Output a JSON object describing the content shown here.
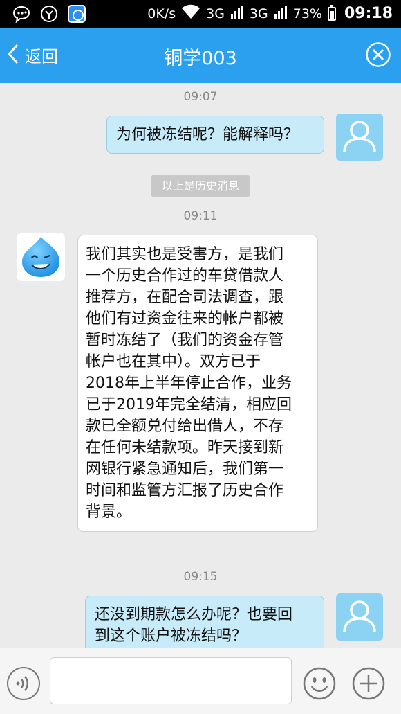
{
  "statusbar": {
    "network_speed": "0K/s",
    "signal1": "3G",
    "signal2": "3G",
    "battery": "73%",
    "time": "09:18"
  },
  "header": {
    "back_label": "返回",
    "title": "铜学003"
  },
  "chat": {
    "time1": "09:07",
    "msg1": "为何被冻结呢？能解释吗？",
    "history_note": "以上是历史消息",
    "time2": "09:11",
    "msg2_lines": [
      "我们其实也是受害方，是我们",
      "一个历史合作过的车贷借款人",
      "推荐方，在配合司法调查，跟",
      "他们有过资金往来的帐户都被",
      "暂时冻结了（我们的资金存管",
      "帐户也在其中）。双方已于",
      "2018年上半年停止合作，业务",
      "已于2019年完全结清，相应回",
      "款已全额兑付给出借人，不存",
      "在任何未结款项。昨天接到新",
      "网银行紧急通知后，我们第一",
      "时间和监管方汇报了历史合作",
      "背景。"
    ],
    "time3": "09:15",
    "msg3_lines": [
      "还没到期款怎么办呢？也要回",
      "到这个账户被冻结吗？"
    ]
  },
  "input": {
    "placeholder": ""
  },
  "colors": {
    "header_bg": "#2aa0ee",
    "outgoing_bubble": "#c8ebfa",
    "user_avatar": "#8cd3f3"
  }
}
